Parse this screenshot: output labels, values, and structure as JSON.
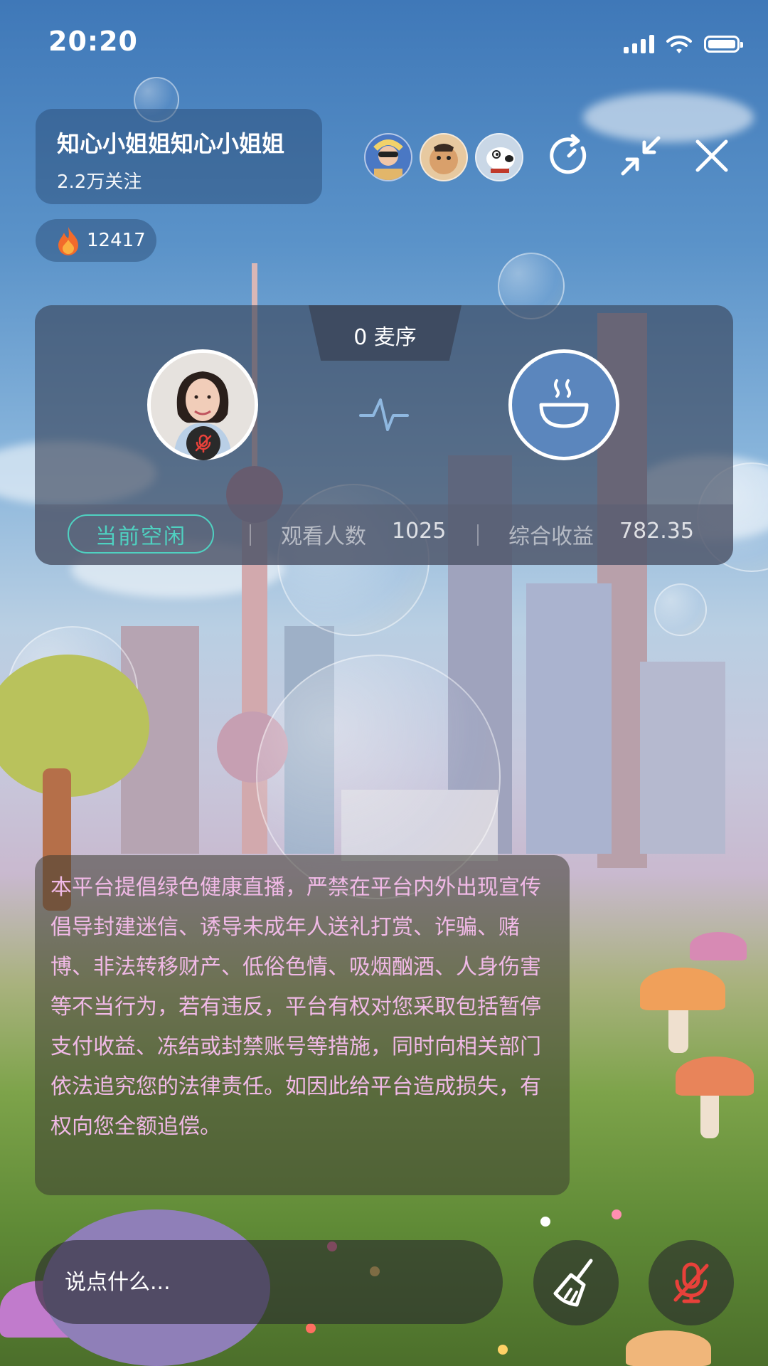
{
  "status_bar": {
    "time": "20:20"
  },
  "header": {
    "host_name": "知心小姐姐知心小姐姐",
    "followers": "2.2万关注",
    "heat": "12417"
  },
  "icons": {
    "refresh": "refresh-icon",
    "minimize": "minimize-icon",
    "close": "close-icon",
    "fire": "fire-icon",
    "mic_muted": "mic-muted-icon",
    "bowl": "bowl-icon",
    "broom": "broom-icon"
  },
  "mic_panel": {
    "mic_order": "0 麦序",
    "status": "当前空闲",
    "viewers_label": "观看人数",
    "viewers_value": "1025",
    "earnings_label": "综合收益",
    "earnings_value": "782.35"
  },
  "notice": {
    "text": "本平台提倡绿色健康直播，严禁在平台内外出现宣传倡导封建迷信、诱导未成年人送礼打赏、诈骗、赌博、非法转移财产、低俗色情、吸烟酗酒、人身伤害等不当行为，若有违反，平台有权对您采取包括暂停支付收益、冻结或封禁账号等措施，同时向相关部门依法追究您的法律责任。如因此给平台造成损失，有权向您全额追偿。"
  },
  "bottom_bar": {
    "input_placeholder": "说点什么..."
  },
  "colors": {
    "status_accent": "#4fd1c1",
    "notice_text": "#f0b9e6",
    "mic_muted_red": "#e8413a",
    "empty_seat": "#5b86bd"
  }
}
